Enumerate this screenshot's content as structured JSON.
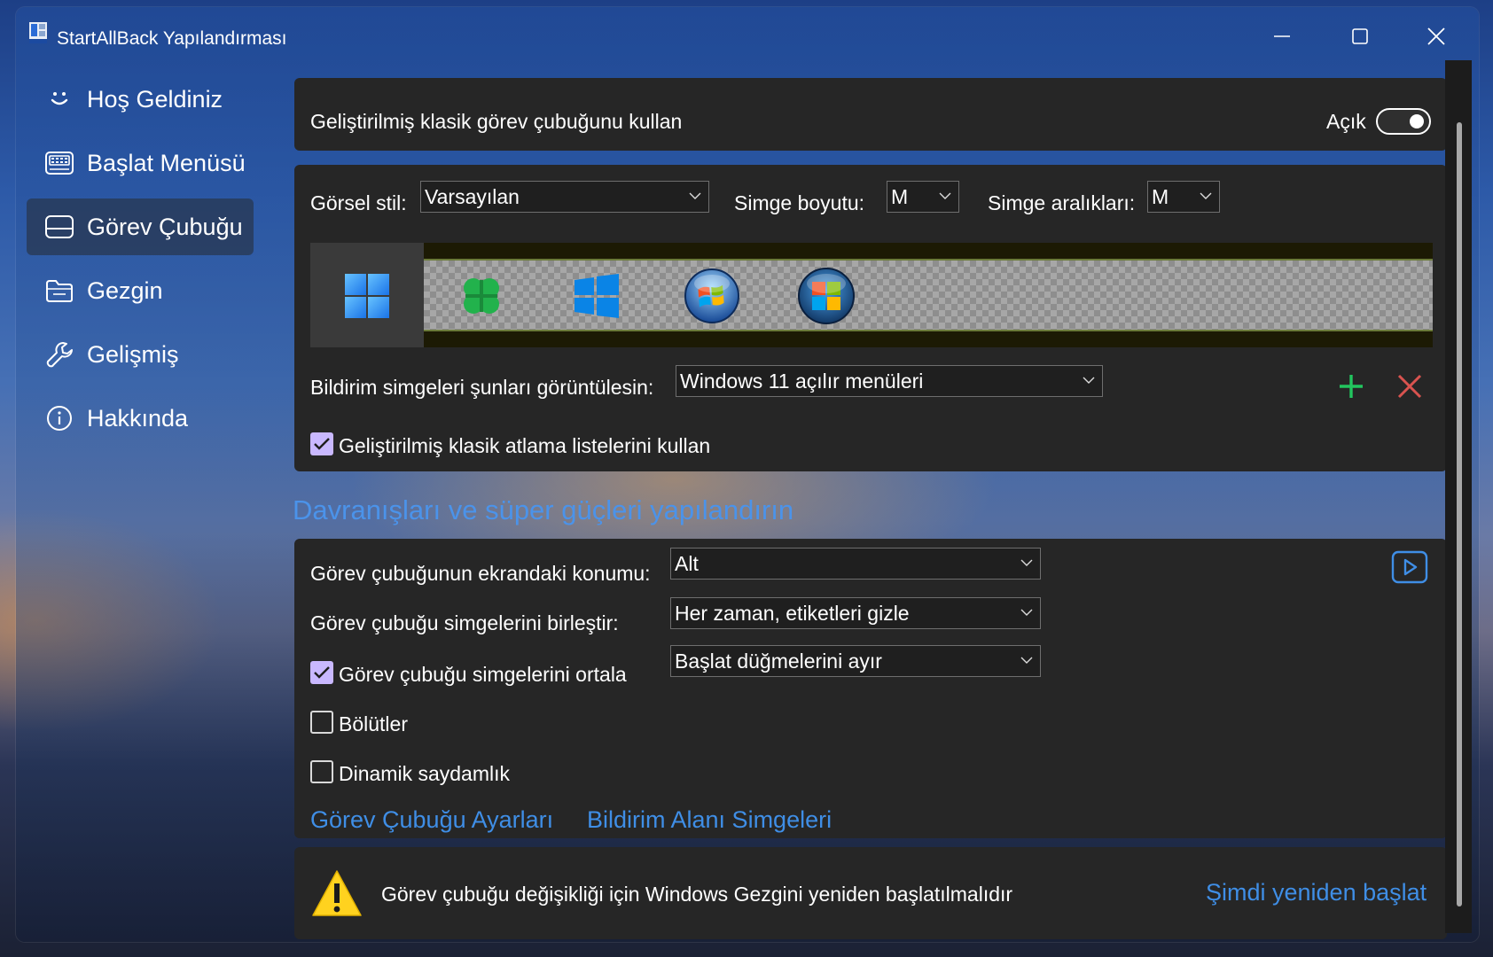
{
  "window": {
    "title": "StartAllBack Yapılandırması"
  },
  "sidebar": {
    "items": [
      {
        "label": "Hoş Geldiniz",
        "icon": "smile-icon"
      },
      {
        "label": "Başlat Menüsü",
        "icon": "start-menu-icon"
      },
      {
        "label": "Görev Çubuğu",
        "icon": "taskbar-icon",
        "active": true
      },
      {
        "label": "Gezgin",
        "icon": "folder-icon"
      },
      {
        "label": "Gelişmiş",
        "icon": "wrench-icon"
      },
      {
        "label": "Hakkında",
        "icon": "info-icon"
      }
    ]
  },
  "main": {
    "enhanced_taskbar": {
      "label": "Geliştirilmiş klasik görev çubuğunu kullan",
      "toggle_label": "Açık",
      "toggle_on": true
    },
    "visual": {
      "style_label": "Görsel stil:",
      "style_value": "Varsayılan",
      "icon_size_label": "Simge boyutu:",
      "icon_size_value": "M",
      "icon_spacing_label": "Simge aralıkları:",
      "icon_spacing_value": "M",
      "start_buttons": [
        "windows-11-logo-icon",
        "clover-logo-icon",
        "windows-10-logo-icon",
        "windows-7-orb-icon",
        "windows-vista-orb-icon"
      ],
      "notif_label": "Bildirim simgeleri şunları görüntülesin:",
      "notif_value": "Windows 11 açılır menüleri",
      "jumplist_label": "Geliştirilmiş klasik atlama listelerini kullan",
      "jumplist_checked": true
    },
    "behaviors": {
      "heading": "Davranışları ve süper güçleri yapılandırın",
      "position_label": "Görev çubuğunun ekrandaki konumu:",
      "position_value": "Alt",
      "combine_label": "Görev çubuğu simgelerini birleştir:",
      "combine_value": "Her zaman, etiketleri gizle",
      "center_label": "Görev çubuğu simgelerini ortala",
      "center_checked": true,
      "center_value": "Başlat düğmelerini ayır",
      "separators_label": "Bölütler",
      "separators_checked": false,
      "transparency_label": "Dinamik saydamlık",
      "transparency_checked": false,
      "link_taskbar_settings": "Görev Çubuğu Ayarları",
      "link_tray_icons": "Bildirim Alanı Simgeleri"
    },
    "restart": {
      "message": "Görev çubuğu değişikliği için Windows Gezgini yeniden başlatılmalıdır",
      "button": "Şimdi yeniden başlat"
    }
  },
  "colors": {
    "accent": "#4b93ea",
    "link": "#3f8ee6",
    "panel": "#262626",
    "check": "#c9b8ff",
    "add": "#22c55e",
    "remove": "#d9534f"
  }
}
